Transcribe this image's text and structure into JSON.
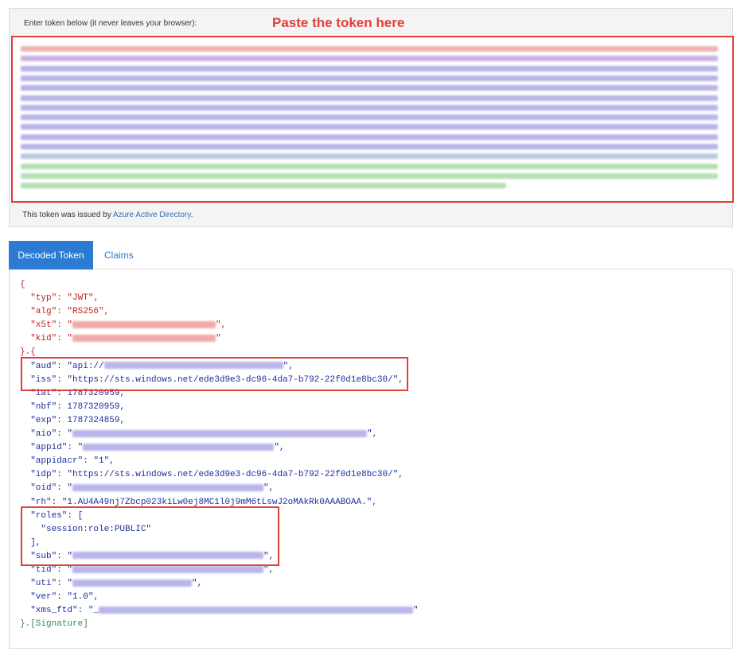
{
  "token_panel": {
    "label": "Enter token below (it never leaves your browser):",
    "callout": "Paste the token here",
    "issued_prefix": "This token was issued by ",
    "issuer_link": "Azure Active Directory",
    "issued_suffix": "."
  },
  "tabs": [
    {
      "label": "Decoded Token",
      "active": true
    },
    {
      "label": "Claims",
      "active": false
    }
  ],
  "decoded": {
    "open_brace": "{",
    "header": [
      {
        "key": "\"typ\"",
        "value": "\"JWT\""
      },
      {
        "key": "\"alg\"",
        "value": "\"RS256\""
      },
      {
        "key": "\"x5t\"",
        "value": ""
      },
      {
        "key": "\"kid\"",
        "value": ""
      }
    ],
    "separator": "}.{",
    "payload": {
      "aud_key": "\"aud\"",
      "aud_value": "\"api://",
      "iss_key": "\"iss\"",
      "iss_value": "\"https://sts.windows.net/ede3d9e3-dc96-4da7-b792-22f0d1e8bc30/\"",
      "iat_key": "\"iat\"",
      "iat_value": "1787320959",
      "nbf_key": "\"nbf\"",
      "nbf_value": "1787320959",
      "exp_key": "\"exp\"",
      "exp_value": "1787324859",
      "aio_key": "\"aio\"",
      "appid_key": "\"appid\"",
      "appidacr_key": "\"appidacr\"",
      "appidacr_value": "\"1\"",
      "idp_key": "\"idp\"",
      "idp_value": "\"https://sts.windows.net/ede3d9e3-dc96-4da7-b792-22f0d1e8bc30/\"",
      "oid_key": "\"oid\"",
      "rh_key": "\"rh\"",
      "rh_value": "\"1.AU4A49nj7Zbcp023kiLw0ej8MC1l0j9mM6tLswJ2oMAkRk0AAABOAA.\"",
      "roles_key": "\"roles\"",
      "roles_item": "\"session:role:PUBLIC\"",
      "sub_key": "\"sub\"",
      "tid_key": "\"tid\"",
      "uti_key": "\"uti\"",
      "ver_key": "\"ver\"",
      "ver_value": "\"1.0\"",
      "xms_key": "\"xms_ftd\"",
      "xms_value": "\"_"
    },
    "signature_close": "}.[Signature]"
  }
}
